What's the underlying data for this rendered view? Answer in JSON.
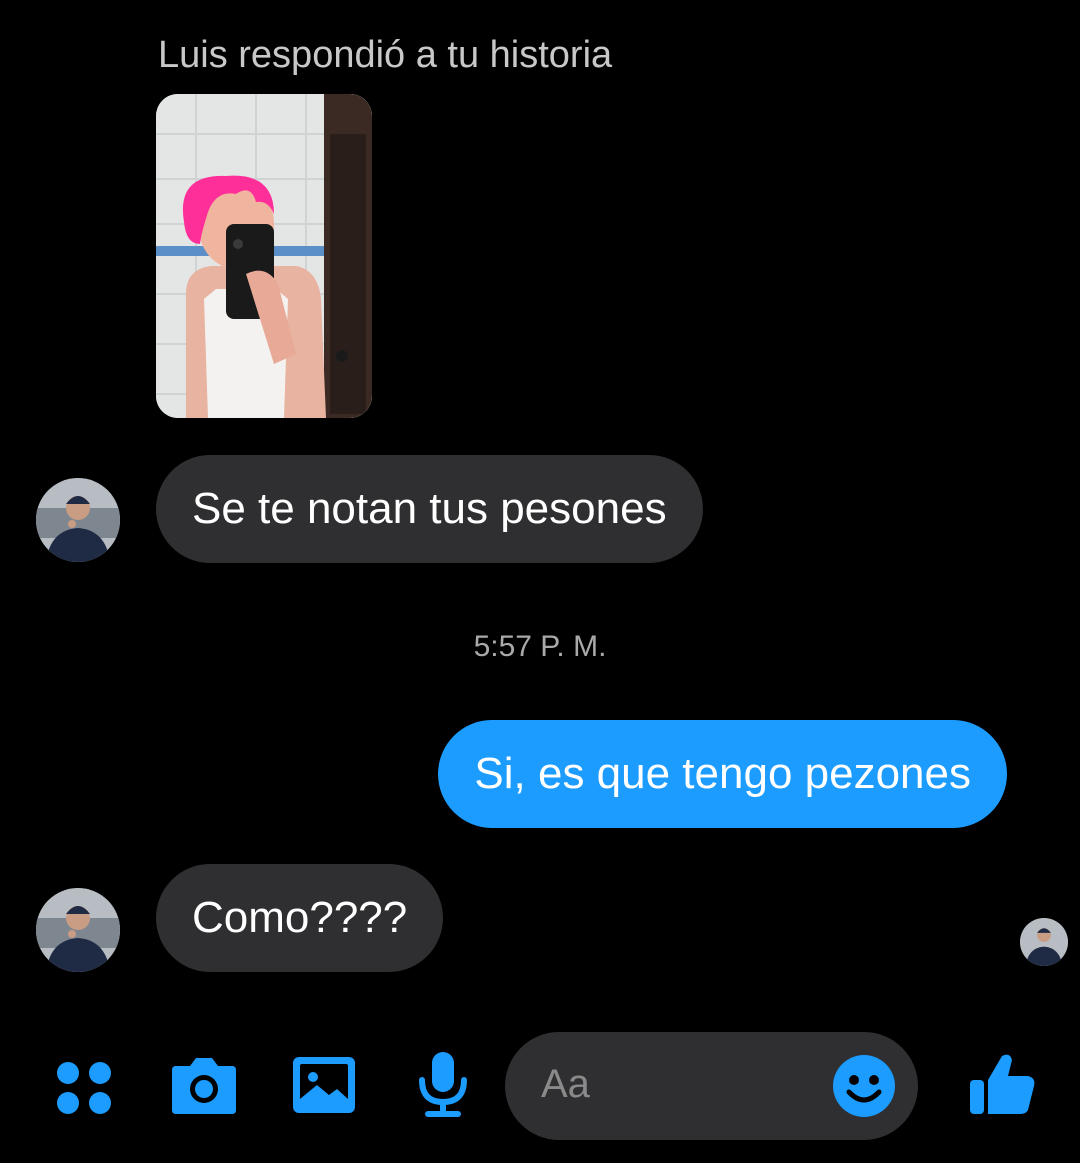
{
  "conversation": {
    "story_reply_label": "Luis respondió a tu historia",
    "timestamp": "5:57 P. M.",
    "messages": [
      {
        "direction": "incoming",
        "text": "Se te notan tus pesones"
      },
      {
        "direction": "outgoing",
        "text": "Si, es que tengo pezones"
      },
      {
        "direction": "incoming",
        "text": "Como????"
      }
    ]
  },
  "composer": {
    "placeholder": "Aa",
    "icons": [
      "apps-grid-icon",
      "camera-icon",
      "gallery-icon",
      "microphone-icon",
      "emoji-icon",
      "thumbs-up-icon"
    ]
  },
  "colors": {
    "background": "#000000",
    "incoming_bubble": "#2f2f31",
    "outgoing_bubble": "#1c9cff",
    "accent": "#1c9cff"
  }
}
